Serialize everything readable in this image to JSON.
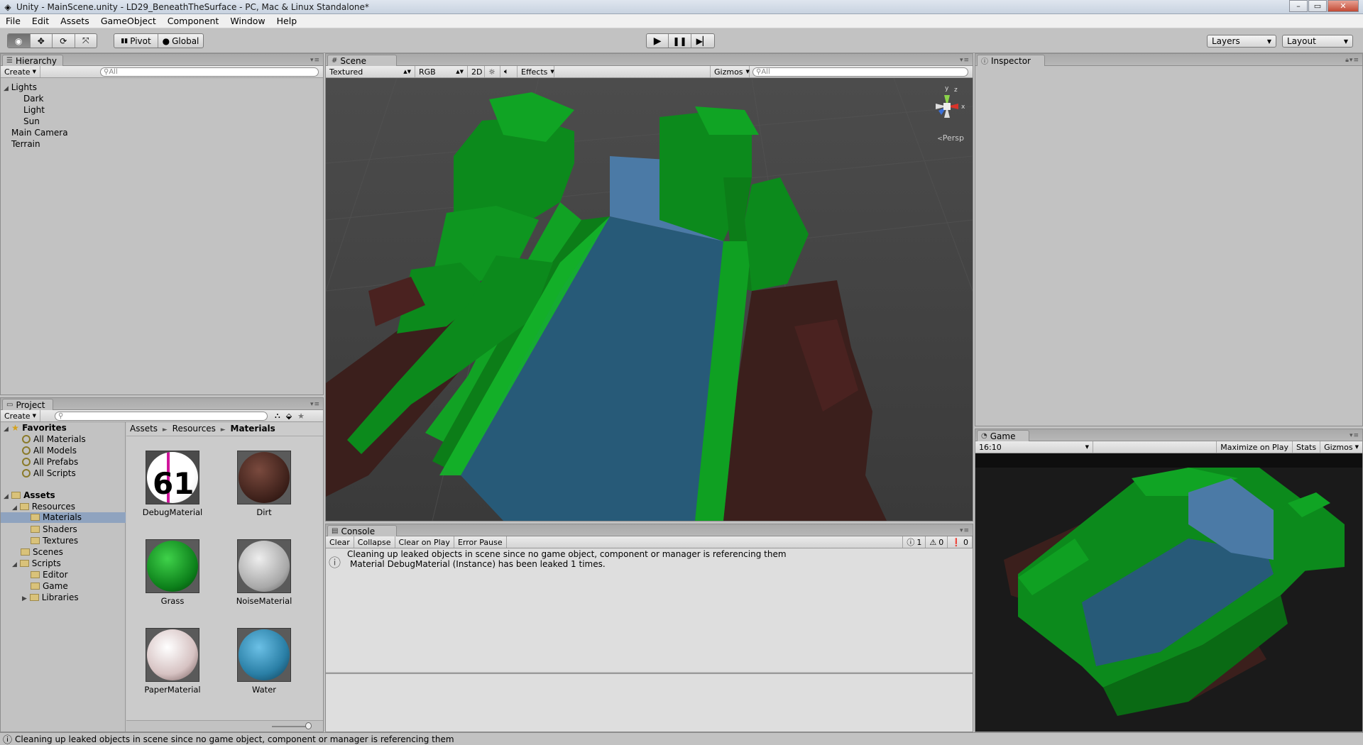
{
  "window": {
    "title": "Unity - MainScene.unity - LD29_BeneathTheSurface - PC, Mac & Linux Standalone*",
    "min": "–",
    "max": "▭",
    "close": "✕"
  },
  "menu": [
    "File",
    "Edit",
    "Assets",
    "GameObject",
    "Component",
    "Window",
    "Help"
  ],
  "toolbar": {
    "pivot": "Pivot",
    "global": "Global",
    "layers": "Layers",
    "layout": "Layout"
  },
  "hierarchy": {
    "tab": "Hierarchy",
    "create": "Create",
    "search_placeholder": "All",
    "items": [
      {
        "label": "Lights",
        "expanded": true
      },
      {
        "label": "Dark",
        "child": true
      },
      {
        "label": "Light",
        "child": true
      },
      {
        "label": "Sun",
        "child": true
      },
      {
        "label": "Main Camera"
      },
      {
        "label": "Terrain"
      }
    ]
  },
  "scene": {
    "tab": "Scene",
    "shading": "Textured",
    "render": "RGB",
    "mode2d": "2D",
    "effects": "Effects",
    "gizmos": "Gizmos",
    "search_placeholder": "All",
    "persp": "Persp",
    "gizmo_axes": {
      "y": "y",
      "x": "x",
      "z": "z"
    }
  },
  "inspector": {
    "tab": "Inspector"
  },
  "game": {
    "tab": "Game",
    "aspect": "16:10",
    "maximize": "Maximize on Play",
    "stats": "Stats",
    "gizmos": "Gizmos"
  },
  "project": {
    "tab": "Project",
    "create": "Create",
    "favorites_label": "Favorites",
    "favorites": [
      "All Materials",
      "All Models",
      "All Prefabs",
      "All Scripts"
    ],
    "assets_label": "Assets",
    "folders": [
      {
        "label": "Resources",
        "level": 1,
        "expanded": true
      },
      {
        "label": "Materials",
        "level": 2,
        "selected": true
      },
      {
        "label": "Shaders",
        "level": 2
      },
      {
        "label": "Textures",
        "level": 2
      },
      {
        "label": "Scenes",
        "level": 1
      },
      {
        "label": "Scripts",
        "level": 1,
        "expanded": true
      },
      {
        "label": "Editor",
        "level": 2
      },
      {
        "label": "Game",
        "level": 2
      },
      {
        "label": "Libraries",
        "level": 2,
        "collapsed": true
      }
    ],
    "breadcrumb": [
      "Assets",
      "Resources",
      "Materials"
    ],
    "materials": [
      {
        "name": "DebugMaterial",
        "color": "#ffffff"
      },
      {
        "name": "Dirt",
        "color": "#4a2a22"
      },
      {
        "name": "Grass",
        "color": "#0f8a1e"
      },
      {
        "name": "NoiseMaterial",
        "color": "#b8b8b8"
      },
      {
        "name": "PaperMaterial",
        "color": "#e2cfcf"
      },
      {
        "name": "Water",
        "color": "#2f7fa6"
      }
    ]
  },
  "console": {
    "tab": "Console",
    "buttons": [
      "Clear",
      "Collapse",
      "Clear on Play",
      "Error Pause"
    ],
    "counts": {
      "info": "1",
      "warn": "0",
      "error": "0"
    },
    "message_line1": "Cleaning up leaked objects in scene since no game object, component or manager is referencing them",
    "message_line2": "Material DebugMaterial (Instance) has been leaked 1 times."
  },
  "status": {
    "message": "Cleaning up leaked objects in scene since no game object, component or manager is referencing them"
  },
  "colors": {
    "grass": "#0c8a1c",
    "grass_light": "#13a526",
    "water": "#275a78",
    "water_wall": "#4b7aa6",
    "dirt": "#3b1f1c"
  }
}
